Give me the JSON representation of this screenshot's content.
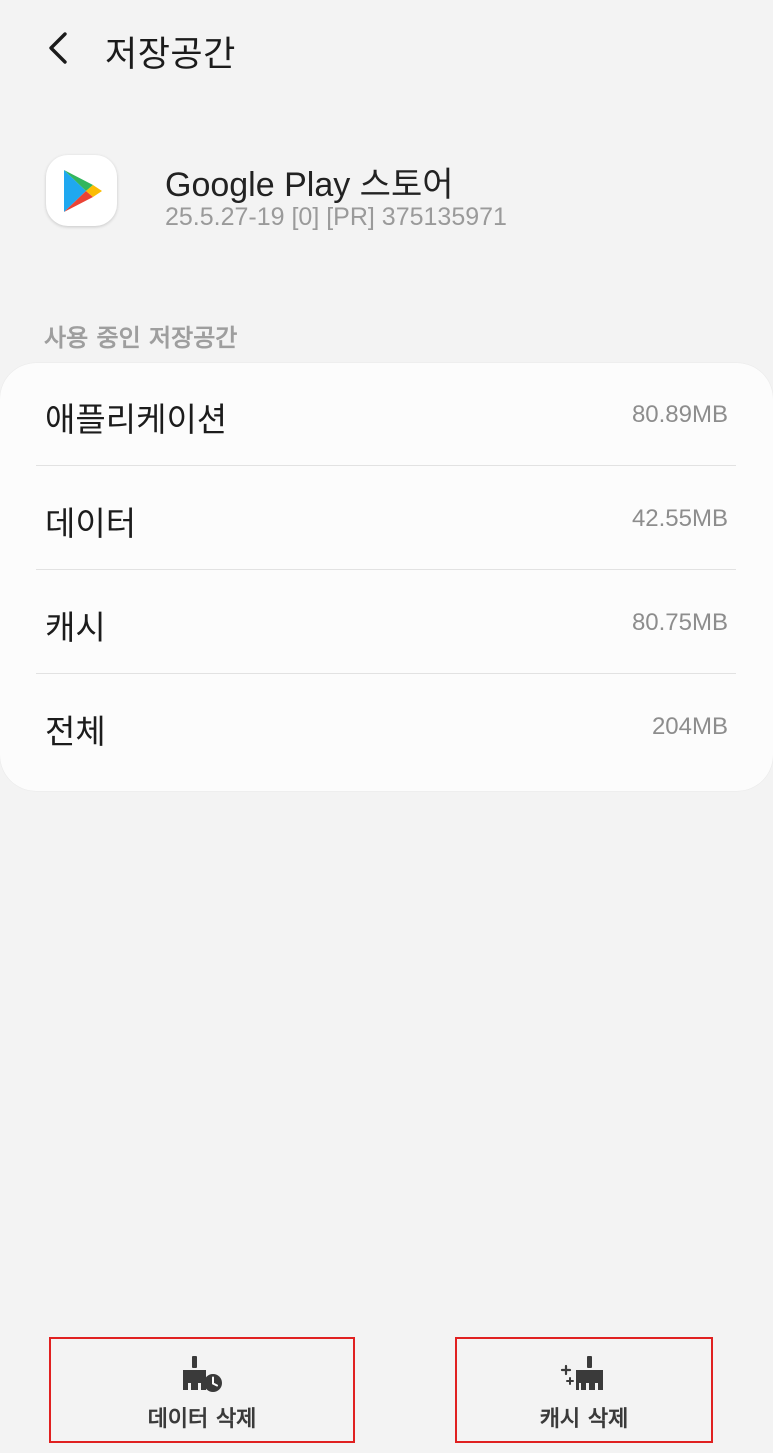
{
  "header": {
    "title": "저장공간",
    "back_icon": "chevron-left-icon"
  },
  "app": {
    "name": "Google Play 스토어",
    "version": "25.5.27-19 [0] [PR] 375135971",
    "icon": "google-play-icon"
  },
  "storage": {
    "section_label": "사용 중인 저장공간",
    "items": [
      {
        "label": "애플리케이션",
        "value": "80.89MB"
      },
      {
        "label": "데이터",
        "value": "42.55MB"
      },
      {
        "label": "캐시",
        "value": "80.75MB"
      },
      {
        "label": "전체",
        "value": "204MB"
      }
    ]
  },
  "actions": {
    "clear_data_label": "데이터 삭제",
    "clear_data_icon": "broom-clock-icon",
    "clear_cache_label": "캐시 삭제",
    "clear_cache_icon": "broom-sparkle-icon",
    "highlight_color": "#e02020"
  }
}
